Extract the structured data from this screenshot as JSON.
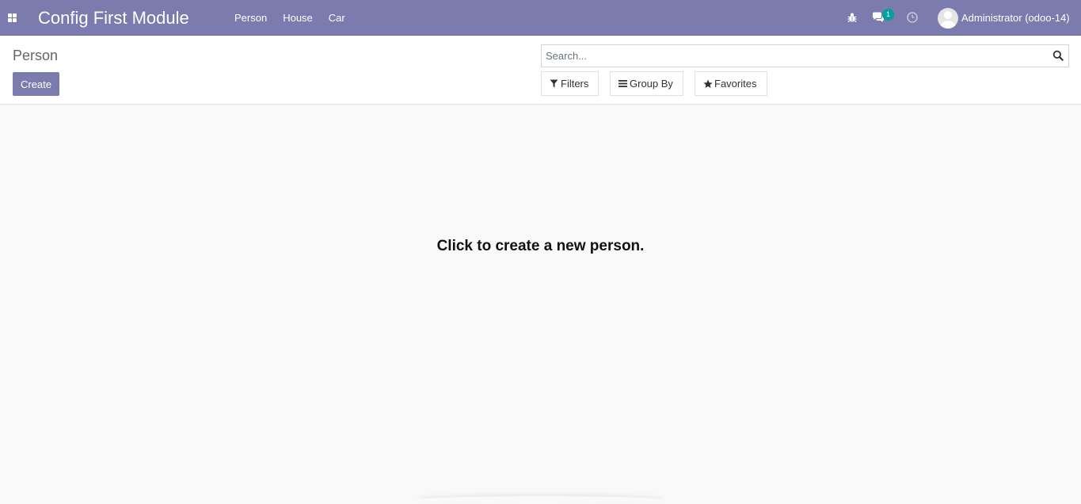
{
  "navbar": {
    "brand": "Config First Module",
    "menu": [
      {
        "label": "Person"
      },
      {
        "label": "House"
      },
      {
        "label": "Car"
      }
    ],
    "systray": {
      "messages_count": "1",
      "user_name": "Administrator (odoo-14)"
    }
  },
  "control_panel": {
    "breadcrumb": "Person",
    "create_label": "Create",
    "search_placeholder": "Search...",
    "filters_label": "Filters",
    "groupby_label": "Group By",
    "favorites_label": "Favorites"
  },
  "content": {
    "help_text": "Click to create a new person."
  },
  "colors": {
    "navbar": "#7c7bad",
    "primary_button": "#7c7bad",
    "badge": "#00a09d",
    "background": "#f9f9f9"
  }
}
